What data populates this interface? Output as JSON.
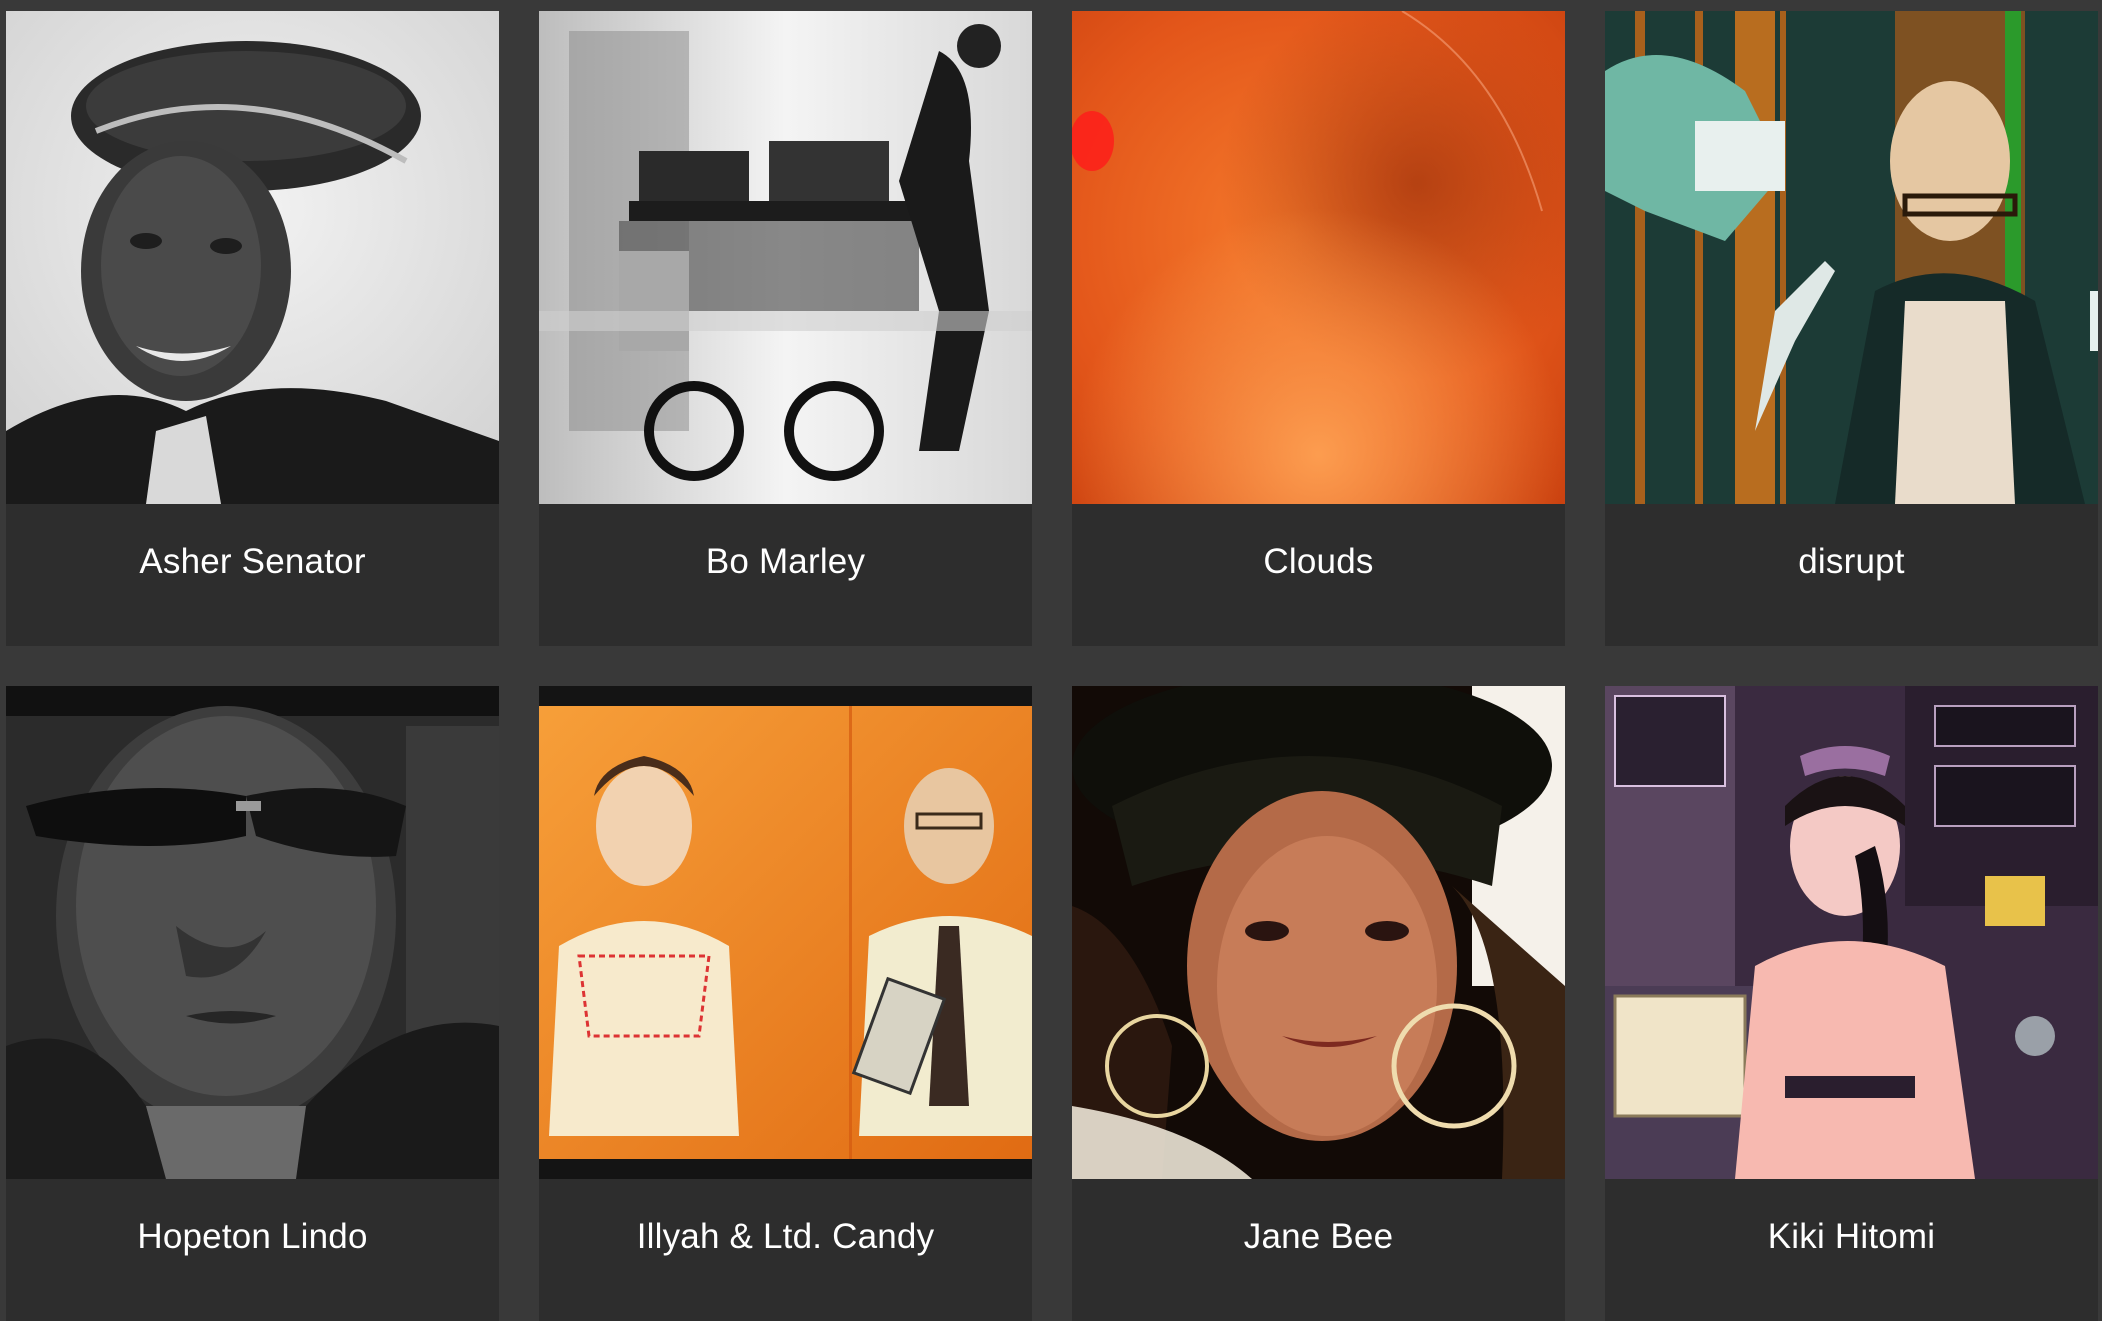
{
  "artists": [
    {
      "name": "Asher Senator",
      "image": "portrait-black-and-white-beret"
    },
    {
      "name": "Bo Marley",
      "image": "motion-blur-electronics-cart"
    },
    {
      "name": "Clouds",
      "image": "orange-blurred-abstract"
    },
    {
      "name": "disrupt",
      "image": "teal-and-brown-halftone-portrait"
    },
    {
      "name": "Hopeton Lindo",
      "image": "portrait-sunglasses-black-and-white"
    },
    {
      "name": "Illyah & Ltd. Candy",
      "image": "duo-orange-backdrop"
    },
    {
      "name": "Jane Bee",
      "image": "portrait-hat-hoop-earrings"
    },
    {
      "name": "Kiki Hitomi",
      "image": "woman-with-synthesizers"
    }
  ],
  "colors": {
    "page_background": "#393939",
    "card_background": "#2d2d2d",
    "label_text": "#ffffff"
  }
}
